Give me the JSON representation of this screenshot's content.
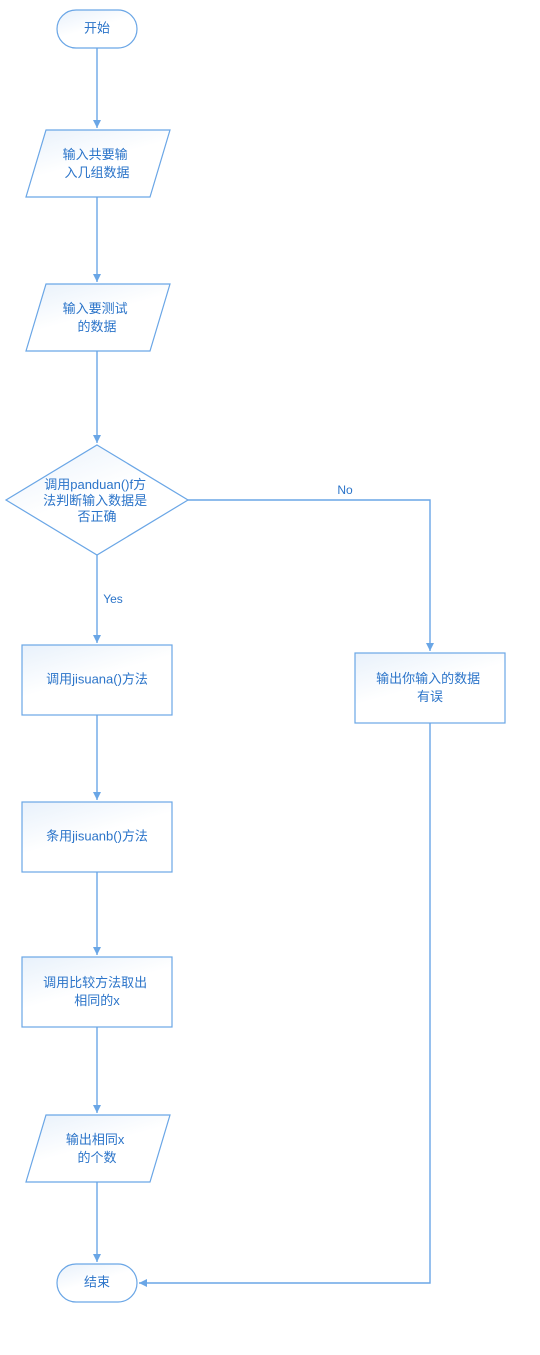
{
  "chart_data": {
    "type": "flowchart",
    "nodes": [
      {
        "id": "start",
        "kind": "terminator",
        "label": "开始"
      },
      {
        "id": "in_count",
        "kind": "io",
        "label": "输入共要输\n入几组数据"
      },
      {
        "id": "in_data",
        "kind": "io",
        "label": "输入要测试\n的数据"
      },
      {
        "id": "dec",
        "kind": "decision",
        "label": "调用panduan()f方\n法判断输入数据是\n否正确"
      },
      {
        "id": "p1",
        "kind": "process",
        "label": "调用jisuana()方法"
      },
      {
        "id": "p2",
        "kind": "process",
        "label": "条用jisuanb()方法"
      },
      {
        "id": "p3",
        "kind": "process",
        "label": "调用比较方法取出\n相同的x"
      },
      {
        "id": "err",
        "kind": "process",
        "label": "输出你输入的数据\n有误"
      },
      {
        "id": "out",
        "kind": "io",
        "label": "输出相同x\n的个数"
      },
      {
        "id": "end",
        "kind": "terminator",
        "label": "结束"
      }
    ],
    "edges": [
      {
        "from": "start",
        "to": "in_count"
      },
      {
        "from": "in_count",
        "to": "in_data"
      },
      {
        "from": "in_data",
        "to": "dec"
      },
      {
        "from": "dec",
        "to": "p1",
        "label": "Yes"
      },
      {
        "from": "dec",
        "to": "err",
        "label": "No"
      },
      {
        "from": "p1",
        "to": "p2"
      },
      {
        "from": "p2",
        "to": "p3"
      },
      {
        "from": "p3",
        "to": "out"
      },
      {
        "from": "out",
        "to": "end"
      },
      {
        "from": "err",
        "to": "end"
      }
    ]
  },
  "labels": {
    "yes": "Yes",
    "no": "No"
  }
}
